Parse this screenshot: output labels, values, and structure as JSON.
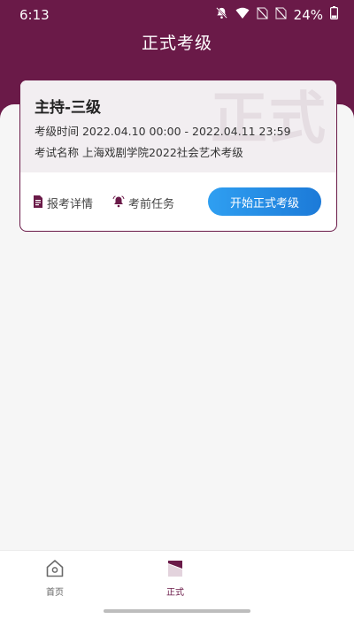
{
  "status_bar": {
    "time": "6:13",
    "battery": "24%",
    "icons": [
      "bell-muted-icon",
      "wifi-icon",
      "sim1-off-icon",
      "sim2-off-icon",
      "battery-icon"
    ]
  },
  "header": {
    "title": "正式考级"
  },
  "card": {
    "title": "主持-三级",
    "watermark": "正式",
    "time_line": "考级时间 2022.04.10 00:00 - 2022.04.11 23:59",
    "name_line": "考试名称 上海戏剧学院2022社会艺术考级",
    "detail_label": "报考详情",
    "task_label": "考前任务",
    "start_label": "开始正式考级"
  },
  "tabs": [
    {
      "label": "首页",
      "icon": "home-icon"
    },
    {
      "label": "正式",
      "icon": "exam-icon"
    }
  ],
  "colors": {
    "brand": "#6a1a48",
    "button_start": "#2f9ff1",
    "button_end": "#1c7ad8"
  }
}
